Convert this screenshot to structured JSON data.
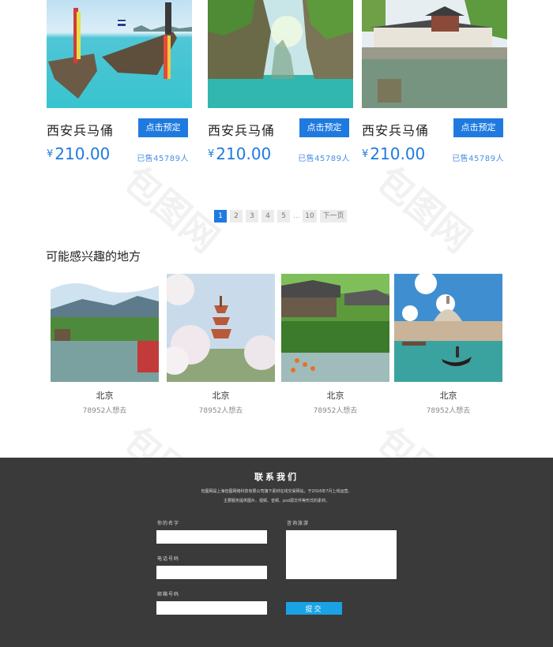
{
  "products": [
    {
      "title": "西安兵马俑",
      "button": "点击预定",
      "currency": "¥",
      "price": "210.00",
      "sold": "已售45789人",
      "image": "longtail-boats-sea"
    },
    {
      "title": "西安兵马俑",
      "button": "点击预定",
      "currency": "¥",
      "price": "210.00",
      "sold": "已售45789人",
      "image": "karst-cliffs-lagoon"
    },
    {
      "title": "西安兵马俑",
      "button": "点击预定",
      "currency": "¥",
      "price": "210.00",
      "sold": "已售45789人",
      "image": "chinese-pavilion-pond"
    }
  ],
  "pagination": {
    "pages": [
      "1",
      "2",
      "3",
      "4",
      "5"
    ],
    "ellipsis": "...",
    "last": "10",
    "next": "下一页",
    "current": "1"
  },
  "interest": {
    "title": "可能感兴趣的地方",
    "places": [
      {
        "name": "北京",
        "count": "78952人想去",
        "image": "lake-village-mountains"
      },
      {
        "name": "北京",
        "count": "78952人想去",
        "image": "pagoda-cherry-blossoms"
      },
      {
        "name": "北京",
        "count": "78952人想去",
        "image": "garden-pond-koi"
      },
      {
        "name": "北京",
        "count": "78952人想去",
        "image": "venice-gondola"
      }
    ]
  },
  "footer": {
    "title": "联系我们",
    "desc_line1": "包图网是上海包图网络科技有限公司旗下素材在线交易网站，于2016年7月上线运营。",
    "desc_line2": "主要服务提供图片、视频、音频、psd源文件等形式的素材。",
    "name_label": "你的名字",
    "phone_label": "电话号码",
    "email_label": "邮箱号码",
    "consult_label": "咨询旅游",
    "submit": "提交",
    "name_value": "",
    "phone_value": "",
    "email_value": "",
    "consult_value": ""
  },
  "watermark": "包图网",
  "colors": {
    "accent": "#1f7ae0",
    "footer_bg": "#3a3a3a",
    "submit": "#1aa3e4"
  }
}
